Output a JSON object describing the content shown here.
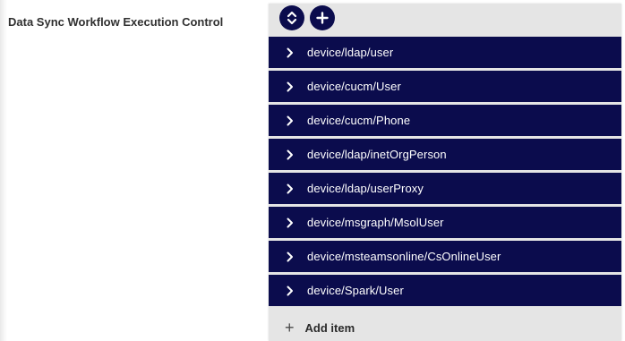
{
  "field": {
    "label": "Data Sync Workflow Execution Control"
  },
  "toolbar": {
    "reorder_icon": "sort-icon",
    "add_icon": "plus-circle-icon"
  },
  "items": [
    {
      "label": "device/ldap/user"
    },
    {
      "label": "device/cucm/User"
    },
    {
      "label": "device/cucm/Phone"
    },
    {
      "label": "device/ldap/inetOrgPerson"
    },
    {
      "label": "device/ldap/userProxy"
    },
    {
      "label": "device/msgraph/MsolUser"
    },
    {
      "label": "device/msteamsonline/CsOnlineUser"
    },
    {
      "label": "device/Spark/User"
    }
  ],
  "add_item": {
    "label": "Add item"
  },
  "colors": {
    "item_bg": "#0b0c4d",
    "panel_bg": "#e5e5e5"
  }
}
